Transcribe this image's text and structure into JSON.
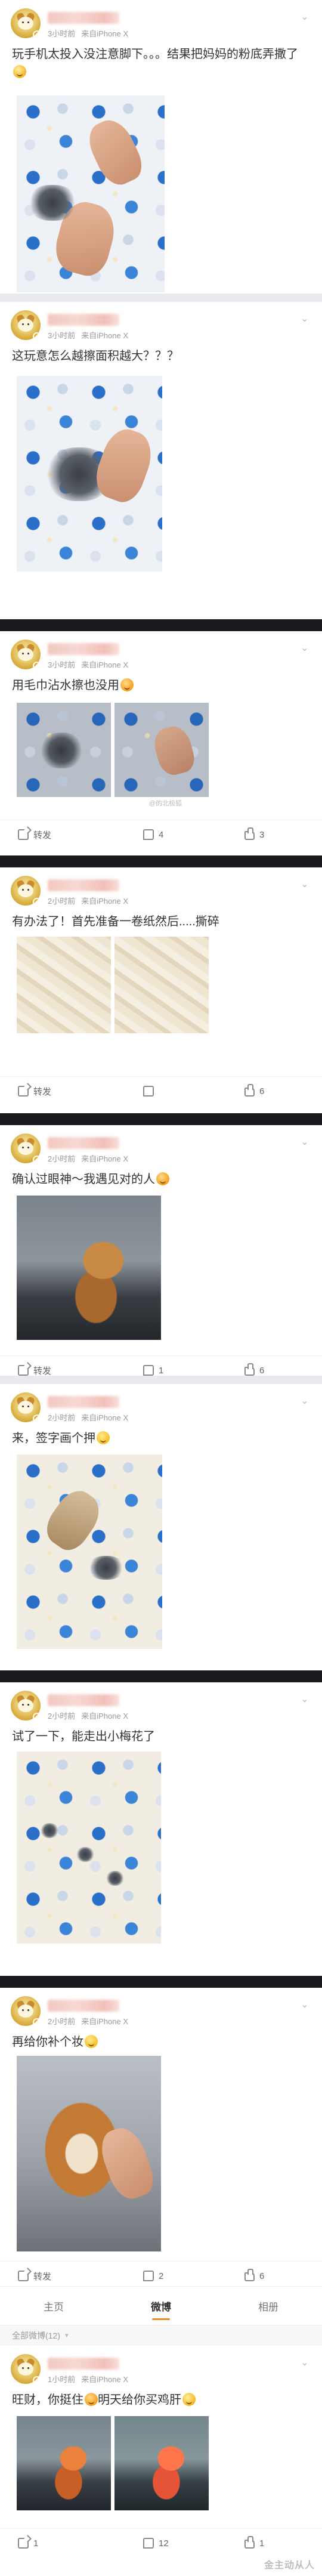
{
  "posts": [
    {
      "meta_time": "3小时前",
      "meta_source": "来自iPhone X",
      "text": "玩手机太投入没注意脚下。。。结果把妈妈的粉底弄撒了",
      "images": [
        "quilt-dog-paws-foundation"
      ]
    },
    {
      "meta_time": "3小时前",
      "meta_source": "来自iPhone X",
      "text": "这玩意怎么越擦面积越大？？？",
      "images": [
        "quilt-smudge-hand"
      ]
    },
    {
      "meta_time": "3小时前",
      "meta_source": "来自iPhone X",
      "text": "用毛巾沾水擦也没用",
      "images": [
        "quilt-left",
        "quilt-right"
      ],
      "actions": {
        "repost": "转发",
        "comment": "4",
        "like": "3"
      }
    },
    {
      "meta_time": "2小时前",
      "meta_source": "来自iPhone X",
      "text": "有办法了！首先准备一卷纸然后.....撕碎",
      "images": [
        "tissue-shred-left",
        "tissue-shred-right"
      ],
      "actions": {
        "repost": "转发",
        "comment": "",
        "like": "6"
      }
    },
    {
      "meta_time": "2小时前",
      "meta_source": "来自iPhone X",
      "text": "确认过眼神～我遇见对的人",
      "images": [
        "dog-on-chair"
      ],
      "actions": {
        "repost": "转发",
        "comment": "1",
        "like": "6"
      }
    },
    {
      "meta_time": "2小时前",
      "meta_source": "来自iPhone X",
      "text": "来，签字画个押",
      "images": [
        "paw-signing"
      ]
    },
    {
      "meta_time": "2小时前",
      "meta_source": "来自iPhone X",
      "text": "试了一下，能走出小梅花了",
      "images": [
        "paw-prints-quilt"
      ]
    },
    {
      "meta_time": "2小时前",
      "meta_source": "来自iPhone X",
      "text": "再给你补个妆",
      "images": [
        "dog-makeup"
      ],
      "actions": {
        "repost": "转发",
        "comment": "2",
        "like": "6"
      }
    },
    {
      "meta_time": "1小时前",
      "meta_source": "来自iPhone X",
      "text": "旺财，你挺住",
      "text2": "明天给你买鸡肝",
      "images": [
        "dog-room-left",
        "dog-room-right"
      ],
      "actions": {
        "repost": "1",
        "comment": "12",
        "like": "1"
      }
    }
  ],
  "tabs": [
    "主页",
    "微博",
    "相册"
  ],
  "all_weibo_label": "全部微博(12)",
  "watermark": "@的北极狐",
  "site_mark": "金主动从人",
  "colors": {
    "accent": "#f08a24",
    "meta": "#999999",
    "text": "#333333"
  }
}
